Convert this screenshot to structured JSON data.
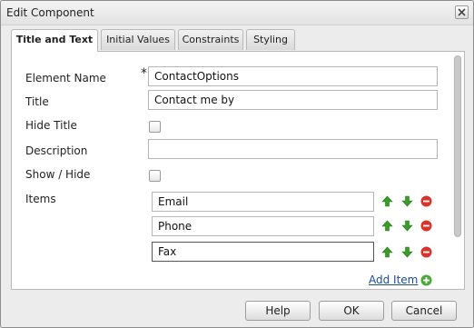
{
  "dialog": {
    "title": "Edit Component",
    "tabs": [
      {
        "label": "Title and Text",
        "active": true
      },
      {
        "label": "Initial Values",
        "active": false
      },
      {
        "label": "Constraints",
        "active": false
      },
      {
        "label": "Styling",
        "active": false
      }
    ]
  },
  "form": {
    "element_name": {
      "label": "Element Name",
      "required_mark": "*",
      "value": "ContactOptions"
    },
    "title": {
      "label": "Title",
      "value": "Contact me by"
    },
    "hide_title": {
      "label": "Hide Title",
      "checked": false
    },
    "description": {
      "label": "Description",
      "value": ""
    },
    "show_hide": {
      "label": "Show / Hide",
      "checked": false
    },
    "items": {
      "label": "Items",
      "values": [
        "Email",
        "Phone",
        "Fax"
      ],
      "add_label": "Add Item"
    }
  },
  "footer": {
    "help_label": "Help",
    "ok_label": "OK",
    "cancel_label": "Cancel"
  },
  "colors": {
    "up_arrow": "#3a9a2a",
    "down_arrow": "#3a9a2a",
    "remove": "#d9342b",
    "link": "#1b4c98"
  },
  "icons": [
    "close-icon",
    "move-up-icon",
    "move-down-icon",
    "remove-icon",
    "add-icon"
  ]
}
